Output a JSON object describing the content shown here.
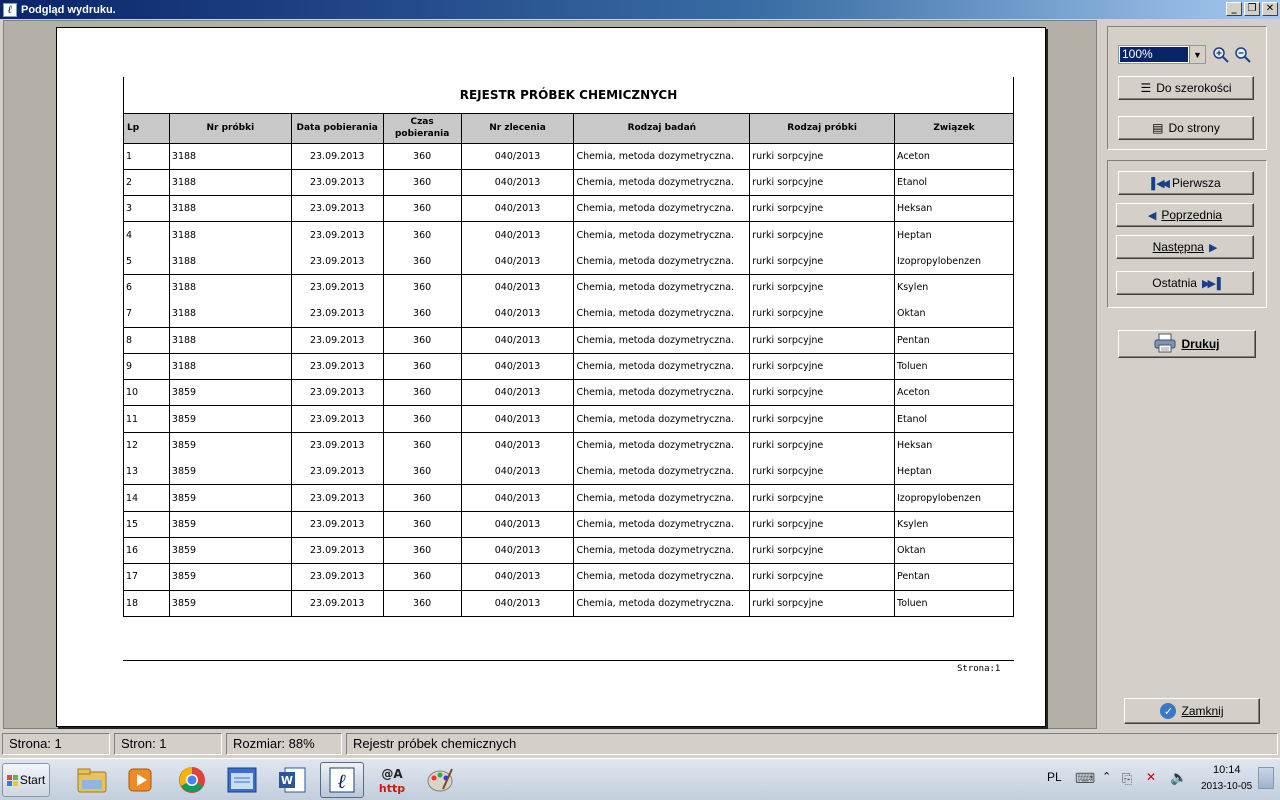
{
  "window": {
    "title": "Podgląd wydruku.",
    "minimize": "_",
    "restore": "❐",
    "close": "✕"
  },
  "report": {
    "title": "REJESTR PRÓBEK CHEMICZNYCH",
    "columns": [
      "Lp",
      "Nr próbki",
      "Data pobierania",
      "Czas pobierania",
      "Nr zlecenia",
      "Rodzaj badań",
      "Rodzaj próbki",
      "Związek"
    ],
    "rows": [
      [
        "1",
        "3188",
        "23.09.2013",
        "360",
        "040/2013",
        "Chemia, metoda dozymetryczna.",
        "rurki sorpcyjne",
        "Aceton"
      ],
      [
        "2",
        "3188",
        "23.09.2013",
        "360",
        "040/2013",
        "Chemia, metoda dozymetryczna.",
        "rurki sorpcyjne",
        "Etanol"
      ],
      [
        "3",
        "3188",
        "23.09.2013",
        "360",
        "040/2013",
        "Chemia, metoda dozymetryczna.",
        "rurki sorpcyjne",
        "Heksan"
      ],
      [
        "4",
        "3188",
        "23.09.2013",
        "360",
        "040/2013",
        "Chemia, metoda dozymetryczna.",
        "rurki sorpcyjne",
        "Heptan"
      ],
      [
        "5",
        "3188",
        "23.09.2013",
        "360",
        "040/2013",
        "Chemia, metoda dozymetryczna.",
        "rurki sorpcyjne",
        "Izopropylobenzen"
      ],
      [
        "6",
        "3188",
        "23.09.2013",
        "360",
        "040/2013",
        "Chemia, metoda dozymetryczna.",
        "rurki sorpcyjne",
        "Ksylen"
      ],
      [
        "7",
        "3188",
        "23.09.2013",
        "360",
        "040/2013",
        "Chemia, metoda dozymetryczna.",
        "rurki sorpcyjne",
        "Oktan"
      ],
      [
        "8",
        "3188",
        "23.09.2013",
        "360",
        "040/2013",
        "Chemia, metoda dozymetryczna.",
        "rurki sorpcyjne",
        "Pentan"
      ],
      [
        "9",
        "3188",
        "23.09.2013",
        "360",
        "040/2013",
        "Chemia, metoda dozymetryczna.",
        "rurki sorpcyjne",
        "Toluen"
      ],
      [
        "10",
        "3859",
        "23.09.2013",
        "360",
        "040/2013",
        "Chemia, metoda dozymetryczna.",
        "rurki sorpcyjne",
        "Aceton"
      ],
      [
        "11",
        "3859",
        "23.09.2013",
        "360",
        "040/2013",
        "Chemia, metoda dozymetryczna.",
        "rurki sorpcyjne",
        "Etanol"
      ],
      [
        "12",
        "3859",
        "23.09.2013",
        "360",
        "040/2013",
        "Chemia, metoda dozymetryczna.",
        "rurki sorpcyjne",
        "Heksan"
      ],
      [
        "13",
        "3859",
        "23.09.2013",
        "360",
        "040/2013",
        "Chemia, metoda dozymetryczna.",
        "rurki sorpcyjne",
        "Heptan"
      ],
      [
        "14",
        "3859",
        "23.09.2013",
        "360",
        "040/2013",
        "Chemia, metoda dozymetryczna.",
        "rurki sorpcyjne",
        "Izopropylobenzen"
      ],
      [
        "15",
        "3859",
        "23.09.2013",
        "360",
        "040/2013",
        "Chemia, metoda dozymetryczna.",
        "rurki sorpcyjne",
        "Ksylen"
      ],
      [
        "16",
        "3859",
        "23.09.2013",
        "360",
        "040/2013",
        "Chemia, metoda dozymetryczna.",
        "rurki sorpcyjne",
        "Oktan"
      ],
      [
        "17",
        "3859",
        "23.09.2013",
        "360",
        "040/2013",
        "Chemia, metoda dozymetryczna.",
        "rurki sorpcyjne",
        "Pentan"
      ],
      [
        "18",
        "3859",
        "23.09.2013",
        "360",
        "040/2013",
        "Chemia, metoda dozymetryczna.",
        "rurki sorpcyjne",
        "Toluen"
      ]
    ],
    "separator_after_rows": [
      1,
      2,
      3,
      5,
      7,
      8,
      9,
      10,
      11,
      13,
      14,
      15,
      16,
      17
    ],
    "page_label": "Strona:1"
  },
  "controls": {
    "zoom_value": "100%",
    "fit_width": "Do szerokości",
    "fit_page": "Do strony",
    "first": "Pierwsza",
    "previous": "Poprzednia",
    "next": "Następna",
    "last": "Ostatnia",
    "print": "Drukuj",
    "close": "Zamknij"
  },
  "status": {
    "page": "Strona: 1",
    "pages": "Stron: 1",
    "size": "Rozmiar: 88%",
    "doc_name": "Rejestr próbek chemicznych"
  },
  "taskbar": {
    "start": "Start",
    "language": "PL",
    "time": "10:14",
    "date": "2013-10-05",
    "icons": [
      "explorer-icon",
      "media-player-icon",
      "chrome-icon",
      "window-app-icon",
      "word-icon",
      "lab-app-icon",
      "http-app-icon",
      "paint-icon"
    ]
  },
  "colors": {
    "header_bg": "#c8c8c8",
    "title_bar": "#0a246a",
    "selection": "#0a246a"
  }
}
